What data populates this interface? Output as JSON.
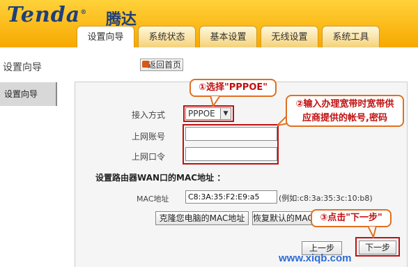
{
  "brand": {
    "logo": "Tenda",
    "logo_cn": "腾达",
    "reg": "®"
  },
  "tabs": [
    {
      "label": "设置向导",
      "active": true
    },
    {
      "label": "系统状态",
      "active": false
    },
    {
      "label": "基本设置",
      "active": false
    },
    {
      "label": "无线设置",
      "active": false
    },
    {
      "label": "系统工具",
      "active": false
    }
  ],
  "sidebar": {
    "title": "设置向导",
    "item": "设置向导"
  },
  "home_button": {
    "label": "返回首页"
  },
  "form": {
    "access_mode_label": "接入方式",
    "access_mode_value": "PPPOE",
    "account_label": "上网账号",
    "account_value": "",
    "password_label": "上网口令",
    "password_value": "",
    "section_title": "设置路由器WAN口的MAC地址 ：",
    "mac_label": "MAC地址",
    "mac_value": "C8:3A:35:F2:E9:a5",
    "mac_example": "(例如:c8:3a:35:3c:10:b8)",
    "clone_mac_button": "克隆您电脑的MAC地址",
    "restore_mac_button": "恢复默认的MAC地址",
    "prev_button": "上一步",
    "next_button": "下一步"
  },
  "callouts": {
    "step1": "①选择\"PPPOE\"",
    "step2_line1": "②输入办理宽带时宽带供",
    "step2_line2": "应商提供的帐号,密码",
    "step3": "③点击\"下一步\""
  },
  "watermark": "www.xiqb.com",
  "colors": {
    "header_top": "#ffd23a",
    "header_bottom": "#f7a800",
    "logo": "#1f3f7a",
    "highlight": "#c01010",
    "callout_border": "#e07020"
  }
}
